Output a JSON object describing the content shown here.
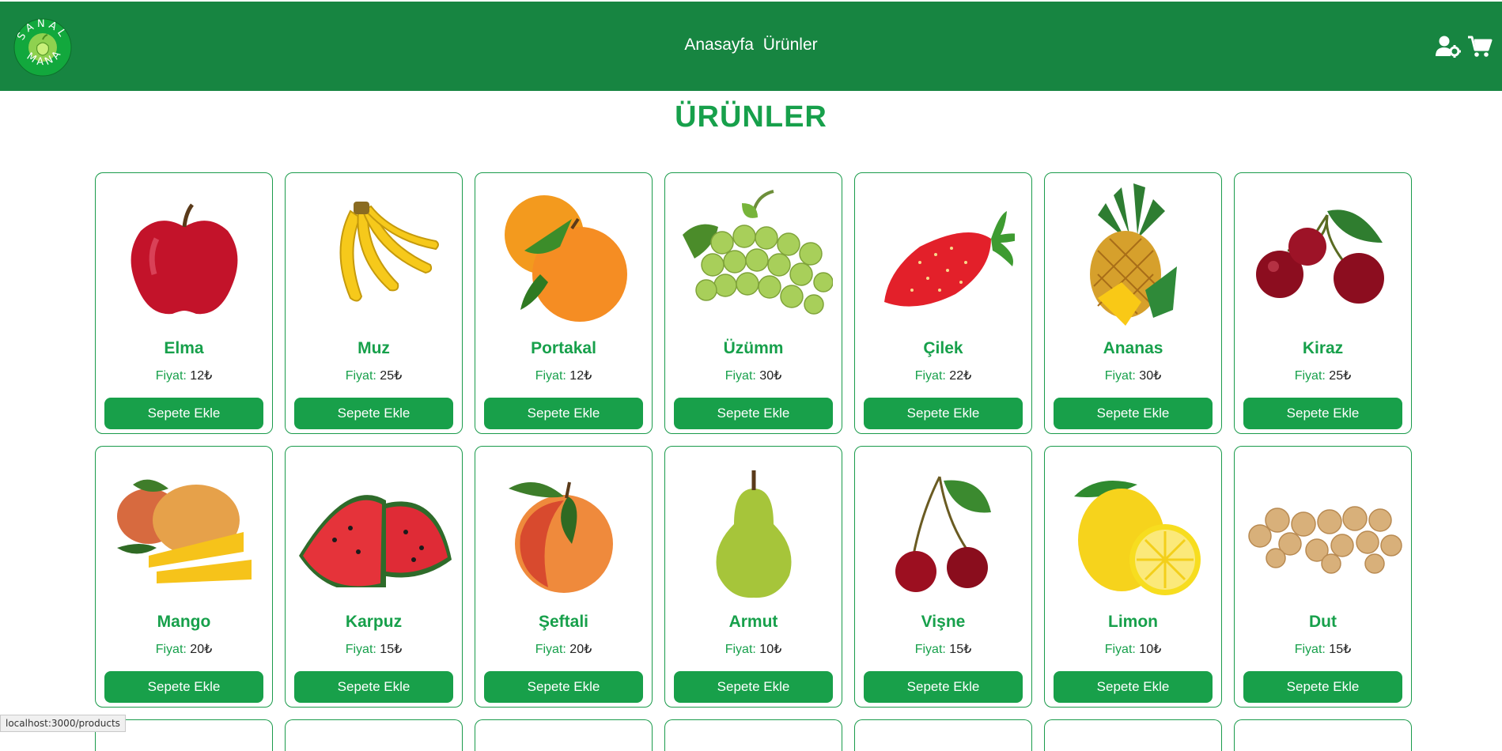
{
  "brand": {
    "logo_text": "SANAL MANAV",
    "colors": {
      "primary": "#178541",
      "accent": "#17a04b"
    }
  },
  "nav": {
    "items": [
      "Anasayfa",
      "Ürünler"
    ]
  },
  "header_icons": [
    "user-gear-icon",
    "cart-icon"
  ],
  "page": {
    "title": "ÜRÜNLER"
  },
  "price_label": "Fiyat:",
  "button_label": "Sepete Ekle",
  "products": [
    {
      "name": "Elma",
      "price": "12₺",
      "icon": "apple"
    },
    {
      "name": "Muz",
      "price": "25₺",
      "icon": "banana"
    },
    {
      "name": "Portakal",
      "price": "12₺",
      "icon": "orange"
    },
    {
      "name": "Üzümm",
      "price": "30₺",
      "icon": "grape"
    },
    {
      "name": "Çilek",
      "price": "22₺",
      "icon": "strawberry"
    },
    {
      "name": "Ananas",
      "price": "30₺",
      "icon": "pineapple"
    },
    {
      "name": "Kiraz",
      "price": "25₺",
      "icon": "cherry"
    },
    {
      "name": "Mango",
      "price": "20₺",
      "icon": "mango"
    },
    {
      "name": "Karpuz",
      "price": "15₺",
      "icon": "watermelon"
    },
    {
      "name": "Şeftali",
      "price": "20₺",
      "icon": "peach"
    },
    {
      "name": "Armut",
      "price": "10₺",
      "icon": "pear"
    },
    {
      "name": "Vişne",
      "price": "15₺",
      "icon": "sour-cherry"
    },
    {
      "name": "Limon",
      "price": "10₺",
      "icon": "lemon"
    },
    {
      "name": "Dut",
      "price": "15₺",
      "icon": "mulberry"
    }
  ],
  "status_bar": {
    "url": "localhost:3000/products"
  }
}
